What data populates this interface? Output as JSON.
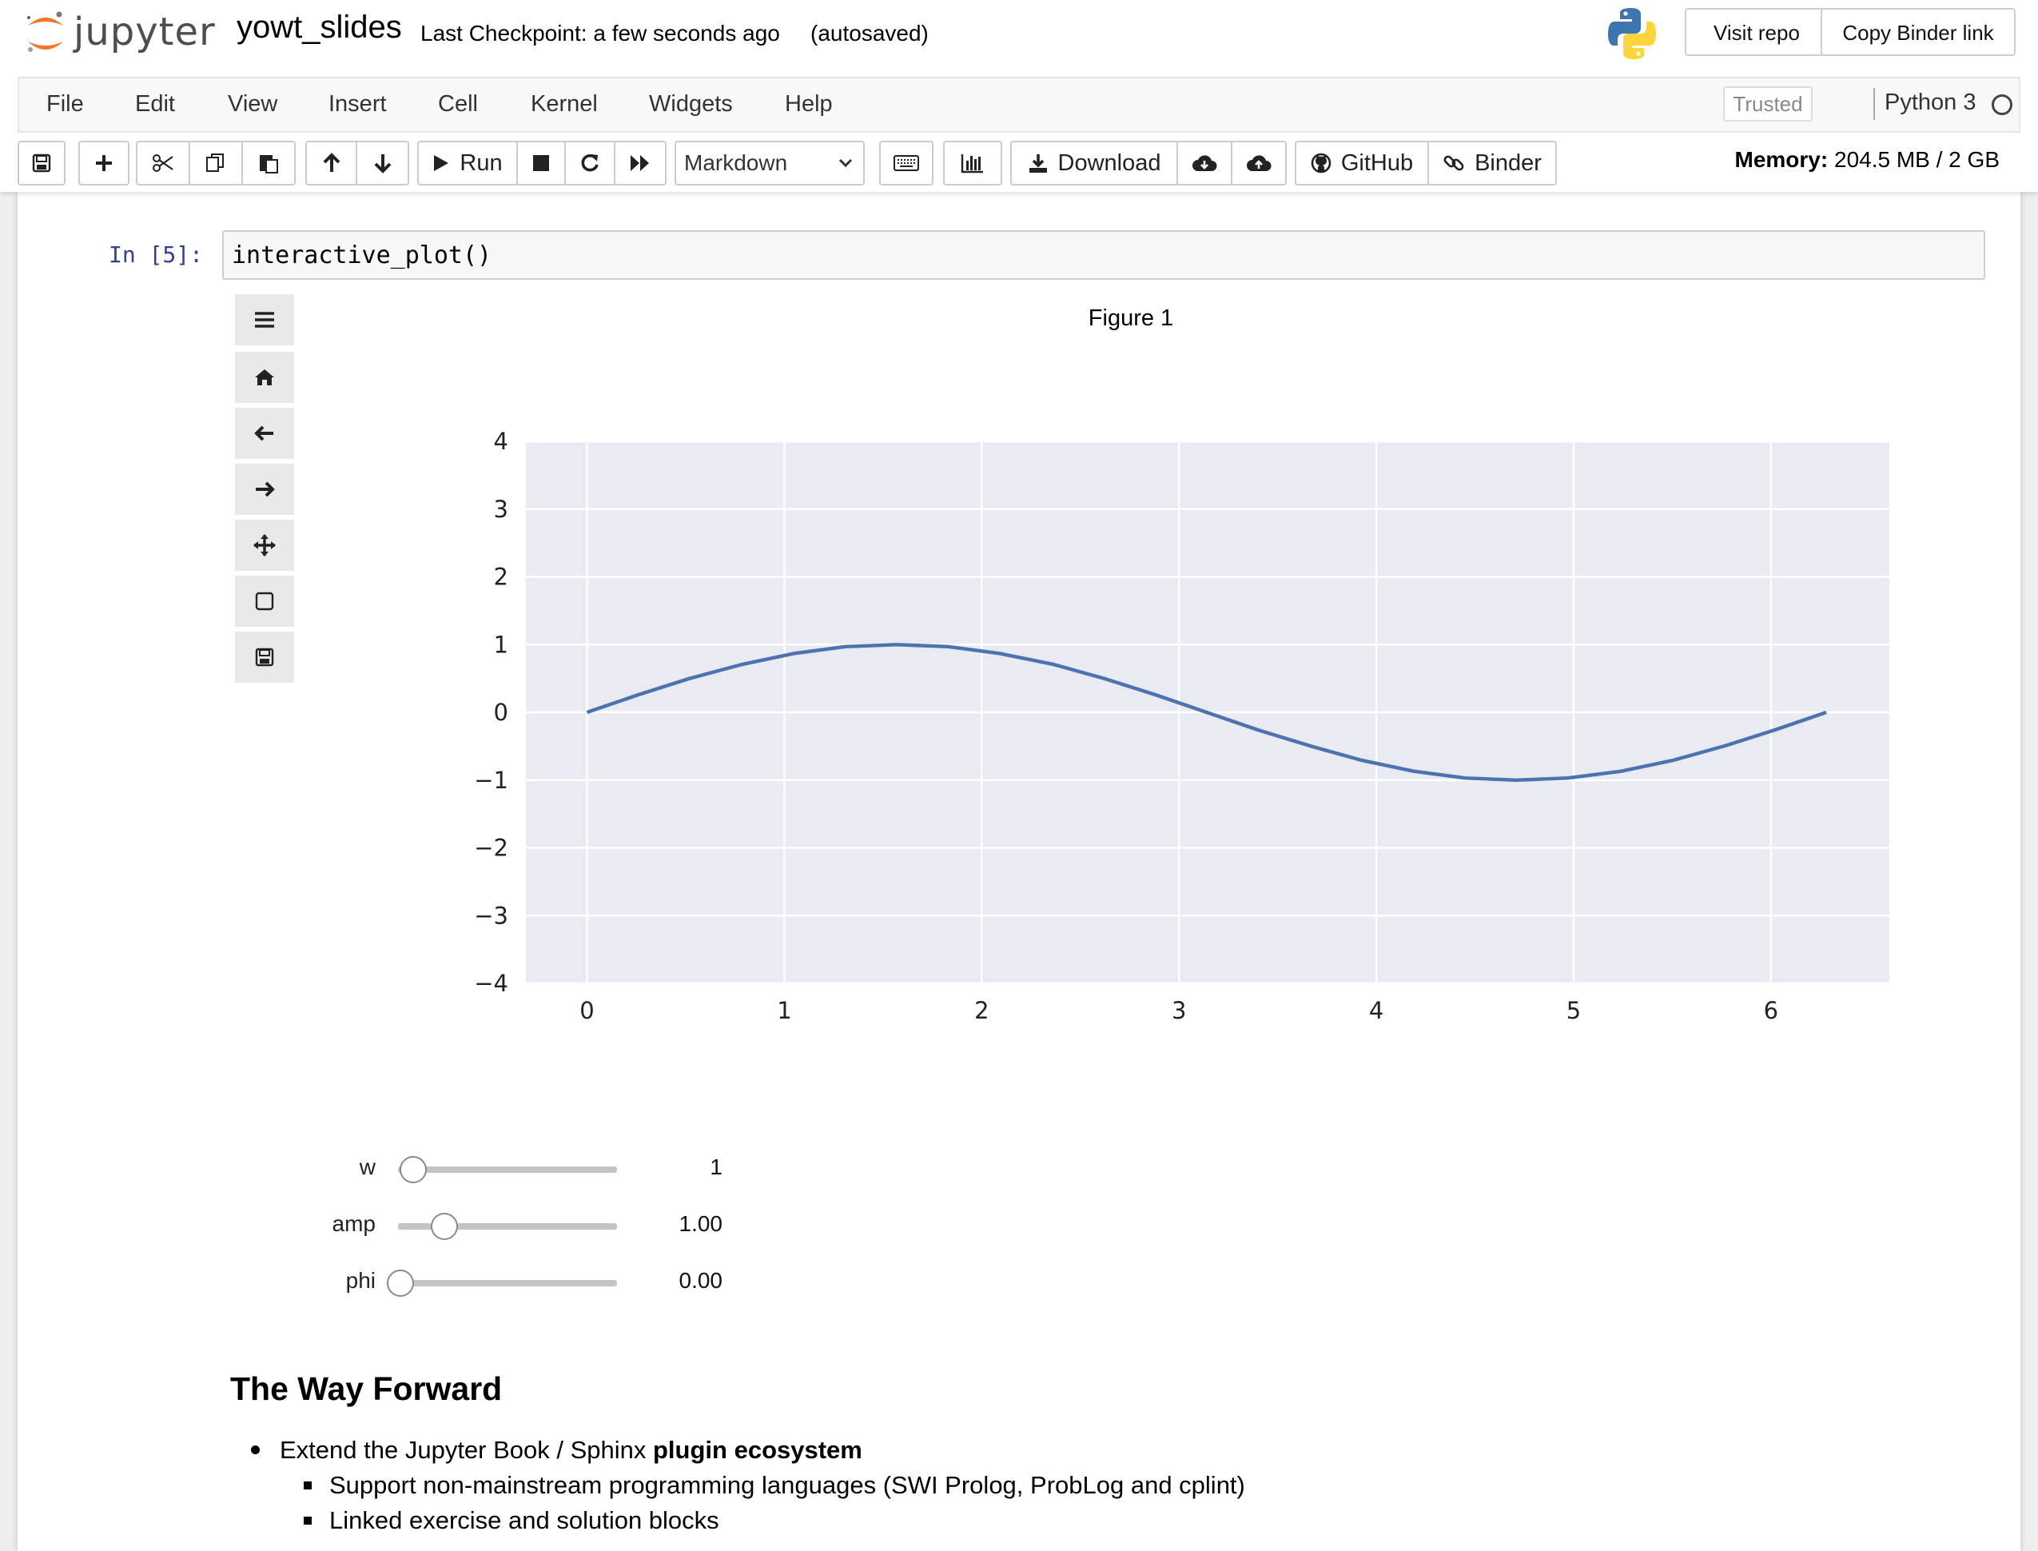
{
  "header": {
    "brand": "jupyter",
    "notebook_name": "yowt_slides",
    "checkpoint": "Last Checkpoint: a few seconds ago",
    "autosave": "(autosaved)",
    "visit_repo": "Visit repo",
    "copy_binder": "Copy Binder link"
  },
  "menubar": {
    "items": [
      "File",
      "Edit",
      "View",
      "Insert",
      "Cell",
      "Kernel",
      "Widgets",
      "Help"
    ],
    "trusted": "Trusted",
    "kernel": "Python 3"
  },
  "toolbar": {
    "run": "Run",
    "cell_type": "Markdown",
    "download": "Download",
    "github": "GitHub",
    "binder": "Binder",
    "memory_label": "Memory:",
    "memory_value": "204.5 MB / 2 GB"
  },
  "cell": {
    "prompt": "In [5]:",
    "code": "interactive_plot()"
  },
  "figure": {
    "title": "Figure 1"
  },
  "chart_data": {
    "type": "line",
    "title": "Figure 1",
    "xlabel": "",
    "ylabel": "",
    "xlim": [
      -0.31,
      6.6
    ],
    "ylim": [
      -4,
      4
    ],
    "xticks": [
      "0",
      "1",
      "2",
      "3",
      "4",
      "5",
      "6"
    ],
    "yticks": [
      "4",
      "3",
      "2",
      "1",
      "0",
      "−1",
      "−2",
      "−3",
      "−4"
    ],
    "grid": true,
    "line_color": "#4c72b0",
    "plot_background": "#eaeaf2",
    "series": [
      {
        "x": [
          0,
          0.26,
          0.52,
          0.79,
          1.05,
          1.31,
          1.57,
          1.83,
          2.09,
          2.36,
          2.62,
          2.88,
          3.14,
          3.4,
          3.67,
          3.93,
          4.19,
          4.45,
          4.71,
          4.97,
          5.24,
          5.5,
          5.76,
          6.02,
          6.28
        ],
        "y": [
          0,
          0.26,
          0.5,
          0.71,
          0.87,
          0.97,
          1,
          0.97,
          0.87,
          0.71,
          0.5,
          0.26,
          0,
          -0.26,
          -0.5,
          -0.71,
          -0.87,
          -0.97,
          -1,
          -0.97,
          -0.87,
          -0.71,
          -0.5,
          -0.26,
          0
        ]
      }
    ]
  },
  "sliders": [
    {
      "label": "w",
      "value": "1",
      "fraction": 0.06
    },
    {
      "label": "amp",
      "value": "1.00",
      "fraction": 0.2
    },
    {
      "label": "phi",
      "value": "0.00",
      "fraction": 0.0
    }
  ],
  "markdown": {
    "heading": "The Way Forward",
    "bullet1_pre": "Extend the Jupyter Book / Sphinx ",
    "bullet1_bold": "plugin ecosystem",
    "sub1": "Support non-mainstream programming languages (SWI Prolog, ProbLog and cplint)",
    "sub2": "Linked exercise and solution blocks"
  }
}
